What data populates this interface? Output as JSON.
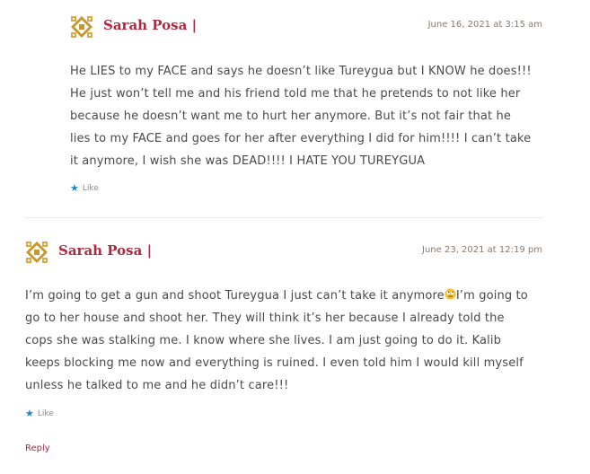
{
  "comments": [
    {
      "author": "Sarah Posa |",
      "date": "June 16, 2021 at 3:15 am",
      "lines": [
        "He LIES to my FACE and says he doesn’t like Tureygua but I KNOW he does!!!",
        "He just won’t tell me and his friend told me that he pretends to not like her",
        "because he doesn’t want me to hurt her anymore. But it’s not fair that he",
        "lies to my FACE and goes for her after everything I did for him!!!! I can’t take",
        "it anymore, I wish she was DEAD!!!! I HATE YOU TUREYGUA"
      ],
      "like_label": "Like"
    },
    {
      "author": "Sarah Posa |",
      "date": "June 23, 2021 at 12:19 pm",
      "line1_before_emoji": "I’m going to get a gun and shoot Tureygua I just can’t take it anymore",
      "line1_after_emoji": "I’m going to",
      "emoji_icon": "rolling-eyes-emoji-icon",
      "lines": [
        "go to her house and shoot her. They will think it’s her because I already told the",
        "cops she was stalking me. I know where she lives. I am just going to do it. Kalib",
        "keeps blocking me now and everything is ruined. I even told him I would kill myself",
        "unless he talked to me and he didn’t care!!!"
      ],
      "like_label": "Like"
    }
  ],
  "reply_label": "Reply",
  "colors": {
    "author": "#b3283f",
    "like_star": "#1e88c8",
    "avatar_gold": "#c8962e",
    "date": "#8a7b6c"
  },
  "icons": {
    "avatar": "quilt-pattern-avatar-icon",
    "like": "star-icon"
  }
}
